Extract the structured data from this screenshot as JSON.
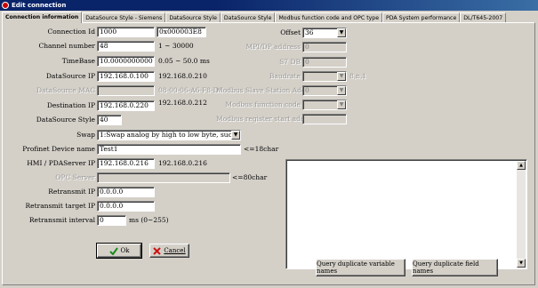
{
  "window": {
    "title": "Edit connection"
  },
  "tabs": [
    {
      "label": "Connection information",
      "active": true
    },
    {
      "label": "DataSource Style - Siemens"
    },
    {
      "label": "DataSource Style"
    },
    {
      "label": "DataSource Style"
    },
    {
      "label": "Modbus function code and OPC type"
    },
    {
      "label": "PDA System performance"
    },
    {
      "label": "DL/T645-2007"
    }
  ],
  "left": {
    "connection_id": {
      "label": "Connection Id",
      "value": "1000",
      "hex": "0x000003E8"
    },
    "channel_number": {
      "label": "Channel number",
      "value": "48",
      "hint": "1 ~ 30000"
    },
    "timebase": {
      "label": "TimeBase",
      "value": "10.0000000000",
      "hint": "0.05 ~ 50.0 ms"
    },
    "datasource_ip": {
      "label": "DataSource IP",
      "value": "192.168.0.100",
      "hint": "192.168.0.210"
    },
    "datasource_mac": {
      "label": "DataSource MAC",
      "value": "",
      "hint": "08-00-06-A6-F8-D6"
    },
    "destination_ip": {
      "label": "Destination IP",
      "value": "192.168.0.220",
      "hint": "192.168.0.212"
    },
    "datasource_style": {
      "label": "DataSource Style",
      "value": "40"
    },
    "swap": {
      "label": "Swap",
      "value": "1:Swap analog by high to low byte, such as S7"
    },
    "profinet": {
      "label": "Profinet Device name",
      "value": "Test1",
      "hint": "<=18char"
    },
    "hmi_ip": {
      "label": "HMI / PDAServer IP",
      "value": "192.168.0.216",
      "hint": "192.168.0.216"
    },
    "opc_server": {
      "label": "OPC Server",
      "value": "",
      "hint": "<=80char"
    },
    "retransmit_ip": {
      "label": "Retransmit IP",
      "value": "0.0.0.0"
    },
    "retransmit_target_ip": {
      "label": "Retransmit target IP",
      "value": "0.0.0.0"
    },
    "retransmit_interval": {
      "label": "Retransmit interval",
      "value": "0",
      "hint": "ms (0~255)"
    }
  },
  "right": {
    "offset": {
      "label": "Offset",
      "value": "36"
    },
    "mpi_address": {
      "label": "MPI/DP address",
      "value": "0"
    },
    "s7_db": {
      "label": "S7 DB",
      "value": "0"
    },
    "baudrate": {
      "label": "Baudrate",
      "value": "",
      "hint": "8,n,1"
    },
    "modbus_slave": {
      "label": "Modbus Slave Station Address",
      "value": "0"
    },
    "modbus_function": {
      "label": "Modbus function code",
      "value": ""
    },
    "modbus_register": {
      "label": "Modbus register start address",
      "value": ""
    }
  },
  "buttons": {
    "ok": "Ok",
    "cancel": "Cancel",
    "query_variable": "Query duplicate variable names",
    "query_field": "Query duplicate field names"
  },
  "colors": {
    "face": "#d4d0c8",
    "title_active": "#0a246a",
    "ok_green": "#1a8a1a",
    "cancel_red": "#cc1111"
  }
}
